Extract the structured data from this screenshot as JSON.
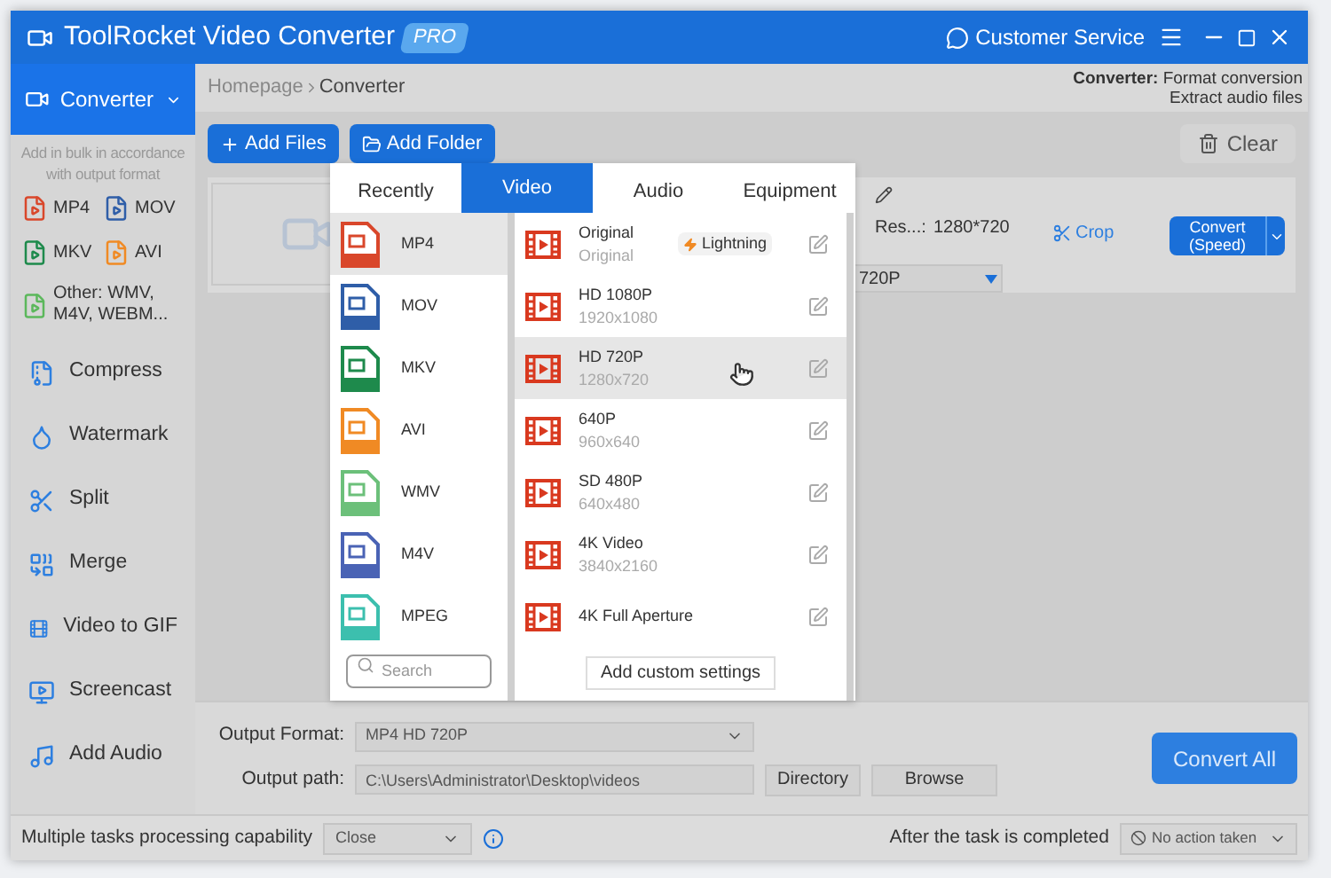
{
  "window": {
    "title": "ToolRocket Video Converter",
    "badge": "PRO",
    "customer_service": "Customer Service"
  },
  "sidebar": {
    "header": {
      "label": "Converter",
      "selected": true
    },
    "hint": "Add in bulk in accordance with output format",
    "formats": [
      {
        "label": "MP4",
        "color": "#d9472b"
      },
      {
        "label": "MOV",
        "color": "#2f5ea8"
      },
      {
        "label": "MKV",
        "color": "#1e8a4c"
      },
      {
        "label": "AVI",
        "color": "#f08a24"
      },
      {
        "label": "Other: WMV, M4V, WEBM...",
        "color": "#5cb85c"
      }
    ],
    "tools": [
      {
        "label": "Compress",
        "kind": "compress"
      },
      {
        "label": "Watermark",
        "kind": "watermark"
      },
      {
        "label": "Split",
        "kind": "split"
      },
      {
        "label": "Merge",
        "kind": "merge"
      },
      {
        "label": "Video to GIF",
        "kind": "gif"
      },
      {
        "label": "Screencast",
        "kind": "screencast"
      },
      {
        "label": "Add Audio",
        "kind": "audio"
      }
    ]
  },
  "breadcrumb": [
    "Homepage",
    "Converter"
  ],
  "info": [
    "**Converter:** Format conversion",
    "Extract audio files"
  ],
  "toolbar": {
    "add_files": "Add Files",
    "add_folder": "Add Folder",
    "clear": "Clear"
  },
  "file_row": {
    "resolution_label": "Res...:",
    "resolution": "1280*720",
    "output": "720P",
    "crop": "Crop",
    "convert": "Convert (Speed)"
  },
  "format_popup": {
    "tabs": [
      {
        "label": "Recently",
        "selected": false
      },
      {
        "label": "Video",
        "selected": true
      },
      {
        "label": "Audio",
        "selected": false
      },
      {
        "label": "Equipment",
        "selected": false
      }
    ],
    "formats": [
      {
        "label": "MP4",
        "color": "#d9472b",
        "selected": true
      },
      {
        "label": "MOV",
        "color": "#2f5ea8",
        "selected": false
      },
      {
        "label": "MKV",
        "color": "#1e8a4c",
        "selected": false
      },
      {
        "label": "AVI",
        "color": "#f08a24",
        "selected": false
      },
      {
        "label": "WMV",
        "color": "#6cc07a",
        "selected": false
      },
      {
        "label": "M4V",
        "color": "#4a63b5",
        "selected": false
      },
      {
        "label": "MPEG",
        "color": "#3cbfae",
        "selected": false
      }
    ],
    "search": {
      "placeholder": "Search"
    },
    "presets": [
      {
        "name": "Original",
        "detail": "Original",
        "badge": "Lightning",
        "selected": false
      },
      {
        "name": "HD 1080P",
        "detail": "1920x1080",
        "selected": false
      },
      {
        "name": "HD 720P",
        "detail": "1280x720",
        "selected": true
      },
      {
        "name": "640P",
        "detail": "960x640",
        "selected": false
      },
      {
        "name": "SD 480P",
        "detail": "640x480",
        "selected": false
      },
      {
        "name": "4K Video",
        "detail": "3840x2160",
        "selected": false
      },
      {
        "name": "4K Full Aperture",
        "selected": false
      }
    ],
    "add_custom": "Add custom settings"
  },
  "output": {
    "format_label": "Output Format:",
    "format_value": "MP4  HD 720P",
    "path_label": "Output path:",
    "path_value": "C:\\Users\\Administrator\\Desktop\\videos",
    "directory": "Directory",
    "browse": "Browse",
    "convert_all": "Convert All"
  },
  "status_bar": {
    "multi_label": "Multiple tasks processing capability",
    "multi_value": "Close",
    "after_label": "After the task is completed",
    "after_value": "No action taken"
  }
}
